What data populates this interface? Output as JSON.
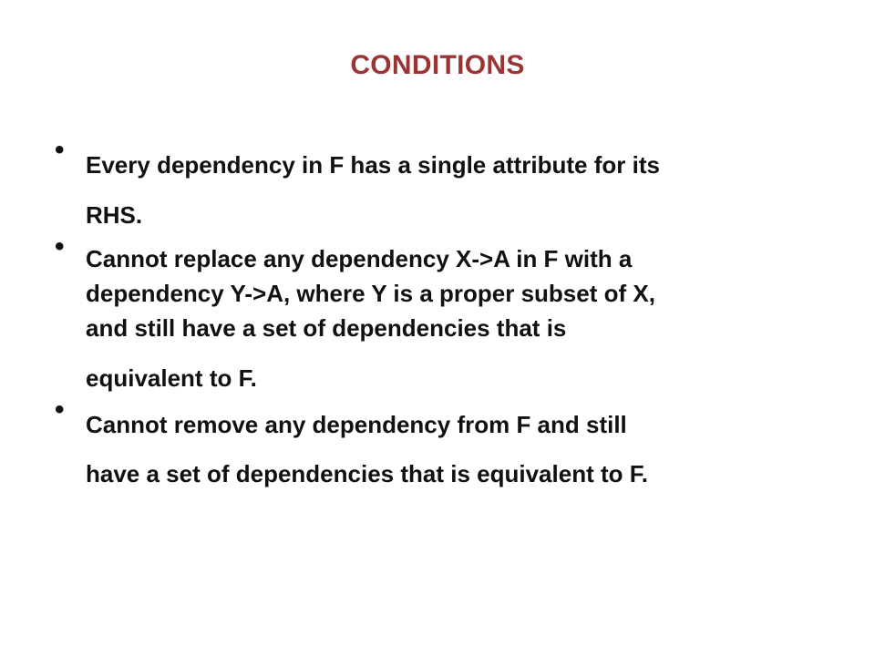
{
  "slide": {
    "title": "CONDITIONS",
    "title_color": "#9b3434",
    "bullets": [
      {
        "lines": [
          "Every dependency in F has a single attribute for its",
          "RHS."
        ]
      },
      {
        "lines": [
          "Cannot replace any dependency X->A in F with a",
          "dependency Y->A, where Y is a proper subset of X,",
          "and still have a set of dependencies that is",
          "equivalent to F."
        ]
      },
      {
        "lines": [
          "Cannot remove any dependency from F and still",
          "have a set of dependencies that is equivalent to F."
        ]
      }
    ],
    "bullet_glyph": "•"
  }
}
